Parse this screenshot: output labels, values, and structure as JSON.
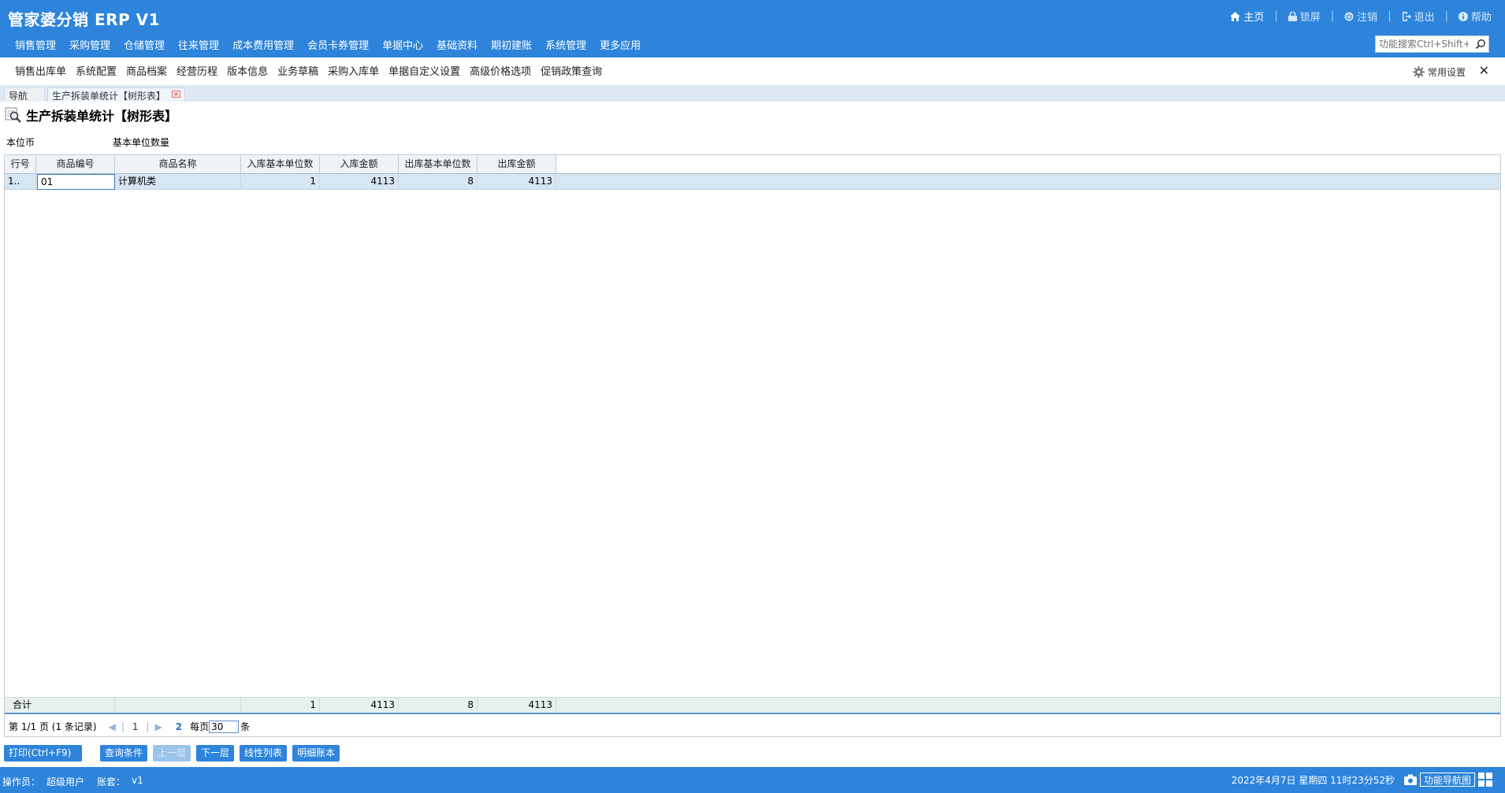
{
  "app": {
    "title": "管家婆分销 ERP V1"
  },
  "top_links": {
    "home": "主页",
    "lock": "锁屏",
    "logout": "注销",
    "exit": "退出",
    "help": "帮助"
  },
  "main_nav": [
    "销售管理",
    "采购管理",
    "仓储管理",
    "往来管理",
    "成本费用管理",
    "会员卡券管理",
    "单据中心",
    "基础资料",
    "期初建账",
    "系统管理",
    "更多应用"
  ],
  "search": {
    "placeholder": "功能搜索Ctrl+Shift+F"
  },
  "sub_nav": [
    "销售出库单",
    "系统配置",
    "商品档案",
    "经营历程",
    "版本信息",
    "业务草稿",
    "采购入库单",
    "单据自定义设置",
    "高级价格选项",
    "促销政策查询"
  ],
  "settings_label": "常用设置",
  "close_glyph": "✕",
  "tabs": {
    "nav": "导航",
    "active": "生产拆装单统计【树形表】",
    "close_glyph": "×"
  },
  "page": {
    "title": "生产拆装单统计【树形表】"
  },
  "filters": {
    "currency": "本位币",
    "unit": "基本单位数量"
  },
  "table": {
    "headers": [
      "行号",
      "商品编号",
      "商品名称",
      "入库基本单位数",
      "入库金额",
      "出库基本单位数",
      "出库金额"
    ],
    "rows": [
      {
        "no": "1..",
        "code": "01",
        "name": "计算机类",
        "in_qty": "1",
        "in_amount": "4113",
        "out_qty": "8",
        "out_amount": "4113"
      }
    ],
    "summary": {
      "label": "合计",
      "in_qty": "1",
      "in_amount": "4113",
      "out_qty": "8",
      "out_amount": "4113"
    }
  },
  "pager": {
    "page_info": "第 1/1 页 (1 条记录)",
    "current": "1",
    "next": "2",
    "per_page_label": "每页",
    "per_page": "30",
    "unit": "条",
    "prev_glyph": "◀",
    "next_glyph": "▶",
    "sep": "|"
  },
  "buttons": {
    "print": "打印(Ctrl+F9)",
    "query": "查询条件",
    "up": "上一层",
    "down": "下一层",
    "linear": "线性列表",
    "detail": "明细账本"
  },
  "status": {
    "operator_label": "操作员：",
    "operator": "超级用户",
    "account_label": "账套：",
    "account": "v1",
    "datetime": "2022年4月7日 星期四 11时23分52秒",
    "navmap": "功能导航图"
  },
  "colors": {
    "brand": "#2d84da",
    "row_highlight": "#d7e6f3",
    "summary_bg": "#e6f0ec"
  }
}
